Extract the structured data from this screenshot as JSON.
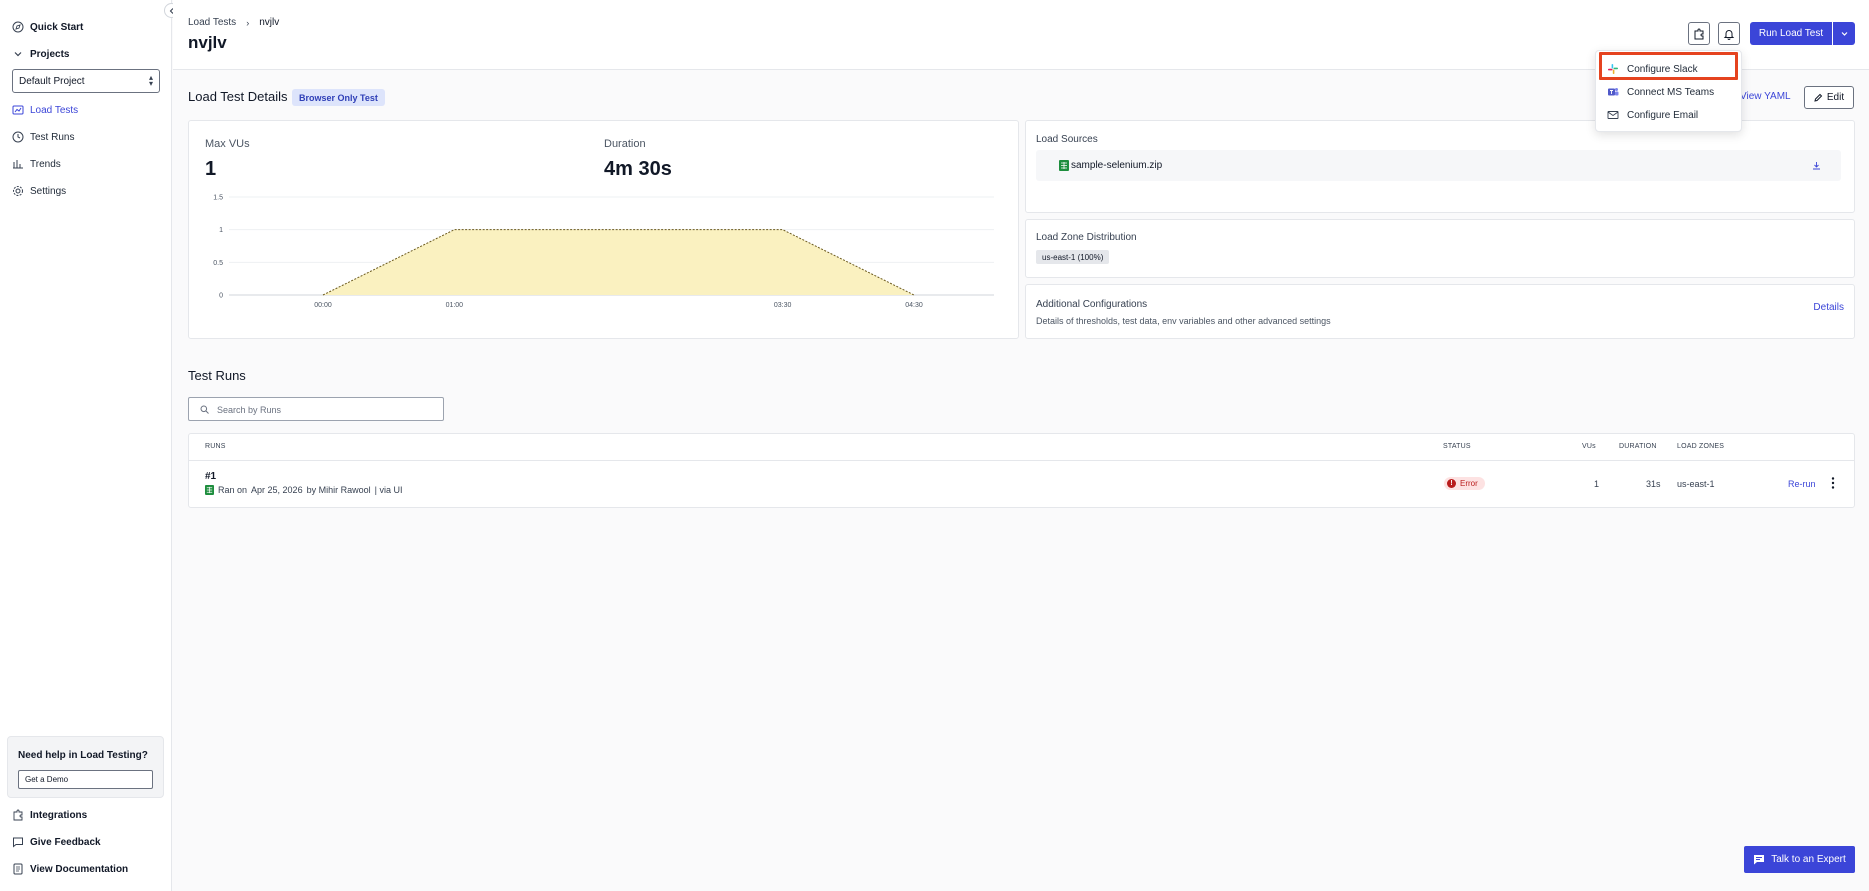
{
  "sidebar": {
    "quick_start": "Quick Start",
    "projects": "Projects",
    "project_selected": "Default Project",
    "items": [
      {
        "label": "Load Tests"
      },
      {
        "label": "Test Runs"
      },
      {
        "label": "Trends"
      },
      {
        "label": "Settings"
      }
    ],
    "help_title": "Need help in Load Testing?",
    "demo_button": "Get a Demo",
    "bottom": [
      {
        "label": "Integrations"
      },
      {
        "label": "Give Feedback"
      },
      {
        "label": "View Documentation"
      }
    ]
  },
  "header": {
    "breadcrumb_root": "Load Tests",
    "breadcrumb_current": "nvjlv",
    "title": "nvjlv",
    "run_button": "Run Load Test"
  },
  "dropdown": {
    "items": [
      {
        "label": "Configure Slack"
      },
      {
        "label": "Connect MS Teams"
      },
      {
        "label": "Configure Email"
      }
    ]
  },
  "details": {
    "title": "Load Test Details",
    "badge": "Browser Only Test",
    "view_yaml": "View YAML",
    "edit": "Edit",
    "max_vus_label": "Max VUs",
    "max_vus_value": "1",
    "duration_label": "Duration",
    "duration_value": "4m 30s"
  },
  "chart_data": {
    "type": "area",
    "x": [
      "00:00",
      "01:00",
      "03:30",
      "04:30"
    ],
    "values": [
      0,
      1,
      1,
      0
    ],
    "y_ticks": [
      "0",
      "0.5",
      "1",
      "1.5"
    ],
    "ylim": [
      0,
      1.5
    ],
    "grid": true,
    "colors": {
      "fill": "#faf1c0",
      "line": "#6b5a1e"
    }
  },
  "sources": {
    "title": "Load Sources",
    "file": "sample-selenium.zip"
  },
  "zones": {
    "title": "Load Zone Distribution",
    "chip": "us-east-1 (100%)"
  },
  "additional": {
    "title": "Additional Configurations",
    "subtitle": "Details of thresholds, test data, env variables and other advanced settings",
    "link": "Details"
  },
  "runs": {
    "title": "Test Runs",
    "search_placeholder": "Search by Runs",
    "columns": {
      "runs": "RUNS",
      "status": "STATUS",
      "vus": "VUs",
      "duration": "DURATION",
      "zones": "LOAD ZONES"
    },
    "rows": [
      {
        "id": "#1",
        "ran_on": "Ran on",
        "date": "Apr 25, 2026",
        "by": "by Mihir Rawool",
        "via": "| via UI",
        "status": "Error",
        "vus": "1",
        "duration": "31s",
        "zone": "us-east-1",
        "action": "Re-run"
      }
    ]
  },
  "talk_button": "Talk to an Expert",
  "colors": {
    "accent": "#3b45d8",
    "error": "#b91c1c",
    "highlight": "#e5431f"
  }
}
